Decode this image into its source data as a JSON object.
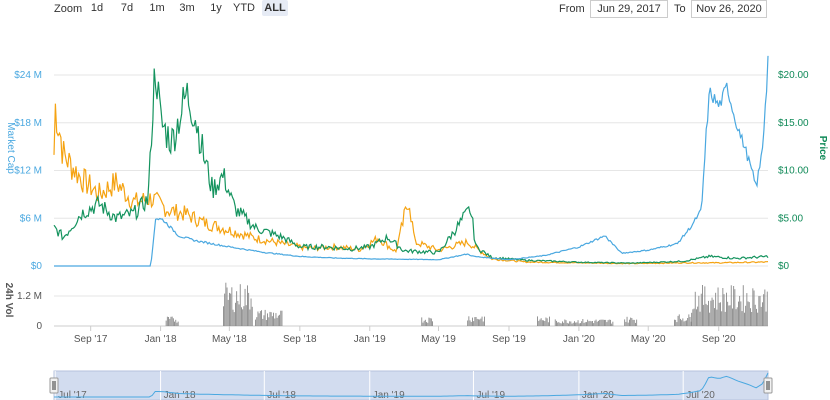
{
  "toolbar": {
    "zoom_label": "Zoom",
    "zoom_buttons": [
      "1d",
      "7d",
      "1m",
      "3m",
      "1y",
      "YTD",
      "ALL"
    ],
    "active_zoom": "ALL",
    "from_label": "From",
    "from_value": "Jun 29, 2017",
    "to_label": "To",
    "to_value": "Nov 26, 2020"
  },
  "colors": {
    "market_cap": "#4aa8e0",
    "price": "#14935e",
    "volume_line": "#f5a312",
    "volume_bars": "#888888",
    "navigator_fill": "#d2dcef"
  },
  "chart_data": {
    "type": "line",
    "x_start": "2017-06-29",
    "x_end": "2020-11-26",
    "x_ticks": [
      "Sep '17",
      "Jan '18",
      "May '18",
      "Sep '18",
      "Jan '19",
      "May '19",
      "Sep '19",
      "Jan '20",
      "May '20",
      "Sep '20"
    ],
    "y_left": {
      "label": "Market Cap",
      "ticks": [
        "$0",
        "$6 M",
        "$12 M",
        "$18 M",
        "$24 M"
      ],
      "range": [
        0,
        24000000
      ]
    },
    "y_right": {
      "label": "Price",
      "ticks": [
        "$0",
        "$5.00",
        "$10.00",
        "$15.00",
        "$20.00"
      ],
      "range": [
        0,
        20
      ]
    },
    "y_volume": {
      "label": "24h Vol",
      "ticks": [
        "0",
        "1.2 M"
      ],
      "range": [
        0,
        1200000
      ]
    },
    "navigator_ticks": [
      "Jul '17",
      "Jan '18",
      "Jul '18",
      "Jan '19",
      "Jul '19",
      "Jan '20",
      "Jul '20"
    ],
    "series": [
      {
        "name": "Market Cap",
        "axis": "left",
        "points": [
          [
            "2017-06-29",
            0
          ],
          [
            "2017-12-15",
            0
          ],
          [
            "2017-12-22",
            6000000
          ],
          [
            "2018-01-05",
            5800000
          ],
          [
            "2018-02-01",
            3800000
          ],
          [
            "2018-03-01",
            3200000
          ],
          [
            "2018-05-01",
            2400000
          ],
          [
            "2018-07-01",
            1700000
          ],
          [
            "2018-09-01",
            1200000
          ],
          [
            "2018-11-01",
            1000000
          ],
          [
            "2019-01-01",
            900000
          ],
          [
            "2019-03-01",
            850000
          ],
          [
            "2019-05-01",
            800000
          ],
          [
            "2019-06-20",
            1500000
          ],
          [
            "2019-07-01",
            1200000
          ],
          [
            "2019-09-01",
            800000
          ],
          [
            "2019-11-01",
            1300000
          ],
          [
            "2020-01-01",
            2400000
          ],
          [
            "2020-02-15",
            3800000
          ],
          [
            "2020-03-15",
            1600000
          ],
          [
            "2020-05-01",
            2000000
          ],
          [
            "2020-06-20",
            2800000
          ],
          [
            "2020-07-15",
            5000000
          ],
          [
            "2020-08-01",
            7000000
          ],
          [
            "2020-08-15",
            22000000
          ],
          [
            "2020-09-01",
            20000000
          ],
          [
            "2020-09-15",
            22500000
          ],
          [
            "2020-10-01",
            18000000
          ],
          [
            "2020-10-20",
            14000000
          ],
          [
            "2020-11-05",
            10000000
          ],
          [
            "2020-11-15",
            14000000
          ],
          [
            "2020-11-26",
            26000000
          ]
        ]
      },
      {
        "name": "Price",
        "axis": "right",
        "points": [
          [
            "2017-06-29",
            4.0
          ],
          [
            "2017-07-15",
            3.0
          ],
          [
            "2017-08-15",
            5.5
          ],
          [
            "2017-09-15",
            6.5
          ],
          [
            "2017-10-15",
            5.0
          ],
          [
            "2017-11-15",
            5.5
          ],
          [
            "2017-12-10",
            7.0
          ],
          [
            "2017-12-22",
            21.5
          ],
          [
            "2018-01-01",
            15.0
          ],
          [
            "2018-01-20",
            13.0
          ],
          [
            "2018-02-15",
            18.0
          ],
          [
            "2018-03-01",
            16.0
          ],
          [
            "2018-03-15",
            12.0
          ],
          [
            "2018-04-01",
            8.0
          ],
          [
            "2018-04-20",
            9.5
          ],
          [
            "2018-05-10",
            6.0
          ],
          [
            "2018-06-15",
            4.0
          ],
          [
            "2018-08-01",
            3.0
          ],
          [
            "2018-09-01",
            2.0
          ],
          [
            "2018-10-15",
            2.0
          ],
          [
            "2018-12-01",
            1.8
          ],
          [
            "2019-01-01",
            2.0
          ],
          [
            "2019-02-01",
            3.0
          ],
          [
            "2019-03-01",
            1.6
          ],
          [
            "2019-04-01",
            1.5
          ],
          [
            "2019-05-01",
            1.4
          ],
          [
            "2019-06-25",
            6.0
          ],
          [
            "2019-07-05",
            2.0
          ],
          [
            "2019-08-01",
            0.9
          ],
          [
            "2019-10-01",
            0.6
          ],
          [
            "2020-01-01",
            0.4
          ],
          [
            "2020-04-01",
            0.3
          ],
          [
            "2020-07-01",
            0.5
          ],
          [
            "2020-08-15",
            1.0
          ],
          [
            "2020-10-01",
            0.8
          ],
          [
            "2020-11-26",
            1.0
          ]
        ]
      },
      {
        "name": "Volume",
        "axis": "left",
        "points": [
          [
            "2017-06-29",
            14000000
          ],
          [
            "2017-07-01",
            20000000
          ],
          [
            "2017-07-15",
            14000000
          ],
          [
            "2017-08-15",
            11000000
          ],
          [
            "2017-09-15",
            9000000
          ],
          [
            "2017-10-15",
            10500000
          ],
          [
            "2017-11-15",
            8000000
          ],
          [
            "2017-12-15",
            8500000
          ],
          [
            "2018-01-15",
            7000000
          ],
          [
            "2018-02-15",
            6500000
          ],
          [
            "2018-03-15",
            5500000
          ],
          [
            "2018-05-01",
            4500000
          ],
          [
            "2018-06-15",
            3500000
          ],
          [
            "2018-08-01",
            2800000
          ],
          [
            "2018-09-15",
            2200000
          ],
          [
            "2018-11-01",
            2400000
          ],
          [
            "2018-12-15",
            2100000
          ],
          [
            "2019-01-15",
            3500000
          ],
          [
            "2019-02-15",
            1800000
          ],
          [
            "2019-03-10",
            8500000
          ],
          [
            "2019-03-20",
            3000000
          ],
          [
            "2019-05-01",
            2000000
          ],
          [
            "2019-06-20",
            3000000
          ],
          [
            "2019-08-01",
            900000
          ],
          [
            "2019-10-01",
            500000
          ],
          [
            "2020-01-01",
            400000
          ],
          [
            "2020-04-01",
            300000
          ],
          [
            "2020-07-01",
            400000
          ],
          [
            "2020-09-01",
            400000
          ],
          [
            "2020-11-26",
            500000
          ]
        ]
      }
    ]
  }
}
